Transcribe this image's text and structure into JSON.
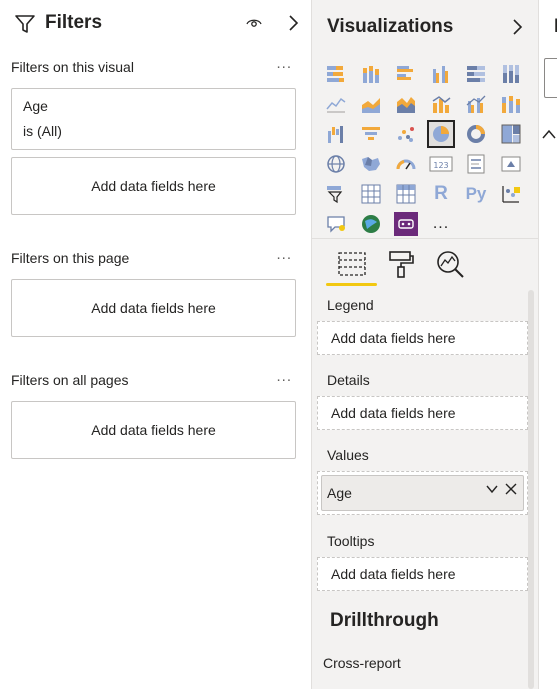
{
  "filters": {
    "title": "Filters",
    "sections": [
      {
        "label": "Filters on this visual",
        "more": "...",
        "card": {
          "field": "Age",
          "condition": "is (All)"
        },
        "drop": "Add data fields here"
      },
      {
        "label": "Filters on this page",
        "more": "...",
        "drop": "Add data fields here"
      },
      {
        "label": "Filters on all pages",
        "more": "...",
        "drop": "Add data fields here"
      }
    ]
  },
  "visualizations": {
    "title": "Visualizations",
    "icons": [
      "stacked-bar-chart-icon",
      "stacked-column-chart-icon",
      "clustered-bar-chart-icon",
      "clustered-column-chart-icon",
      "100-stacked-bar-chart-icon",
      "100-stacked-column-chart-icon",
      "line-chart-icon",
      "area-chart-icon",
      "stacked-area-chart-icon",
      "line-and-stacked-column-icon",
      "line-and-clustered-column-icon",
      "ribbon-chart-icon",
      "waterfall-chart-icon",
      "funnel-icon",
      "scatter-chart-icon",
      "pie-chart-icon",
      "donut-chart-icon",
      "treemap-icon",
      "map-icon",
      "filled-map-icon",
      "gauge-icon",
      "card-icon",
      "multi-row-card-icon",
      "kpi-icon",
      "slicer-icon",
      "table-icon",
      "matrix-icon",
      "r-script-visual-icon",
      "python-visual-icon",
      "key-influencers-icon",
      "qa-visual-icon",
      "arcgis-map-icon",
      "custom-visual-icon",
      "more-visuals-icon"
    ],
    "r_label": "R",
    "py_label": "Py",
    "more_label": "...",
    "selected_icon": "pie-chart-icon",
    "tabs": [
      "fields-tab-icon",
      "format-tab-icon",
      "analytics-tab-icon"
    ],
    "wells": [
      {
        "label": "Legend",
        "placeholder": "Add data fields here"
      },
      {
        "label": "Details",
        "placeholder": "Add data fields here"
      },
      {
        "label": "Values",
        "field": "Age"
      },
      {
        "label": "Tooltips",
        "placeholder": "Add data fields here"
      }
    ],
    "drillthrough": {
      "title": "Drillthrough",
      "cross_report": "Cross-report"
    }
  },
  "fields": {
    "title_letter": "I"
  },
  "colors": {
    "accent": "#f2c811",
    "pane_bg": "#f3f2f1",
    "border": "#c8c6c4"
  }
}
